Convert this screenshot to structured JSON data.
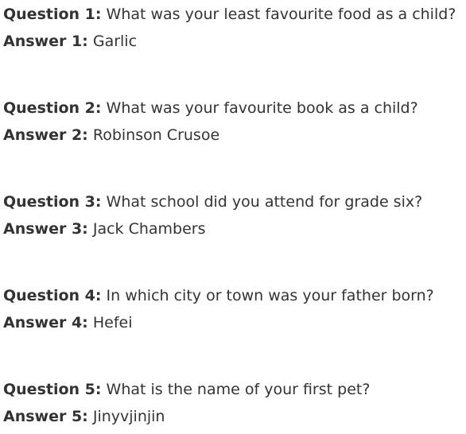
{
  "items": [
    {
      "question_label": "Question 1:",
      "question": "What was your least favourite food as a child?",
      "answer_label": "Answer 1:",
      "answer": "Garlic"
    },
    {
      "question_label": "Question 2:",
      "question": "What was your favourite book as a child?",
      "answer_label": "Answer 2:",
      "answer": "Robinson Crusoe"
    },
    {
      "question_label": "Question 3:",
      "question": "What school did you attend for grade six?",
      "answer_label": "Answer 3:",
      "answer": "Jack Chambers"
    },
    {
      "question_label": "Question 4:",
      "question": "In which city or town was your father born?",
      "answer_label": "Answer 4:",
      "answer": "Hefei"
    },
    {
      "question_label": "Question 5:",
      "question": "What is the name of your first pet?",
      "answer_label": "Answer 5:",
      "answer": "Jinyvjinjin"
    }
  ]
}
